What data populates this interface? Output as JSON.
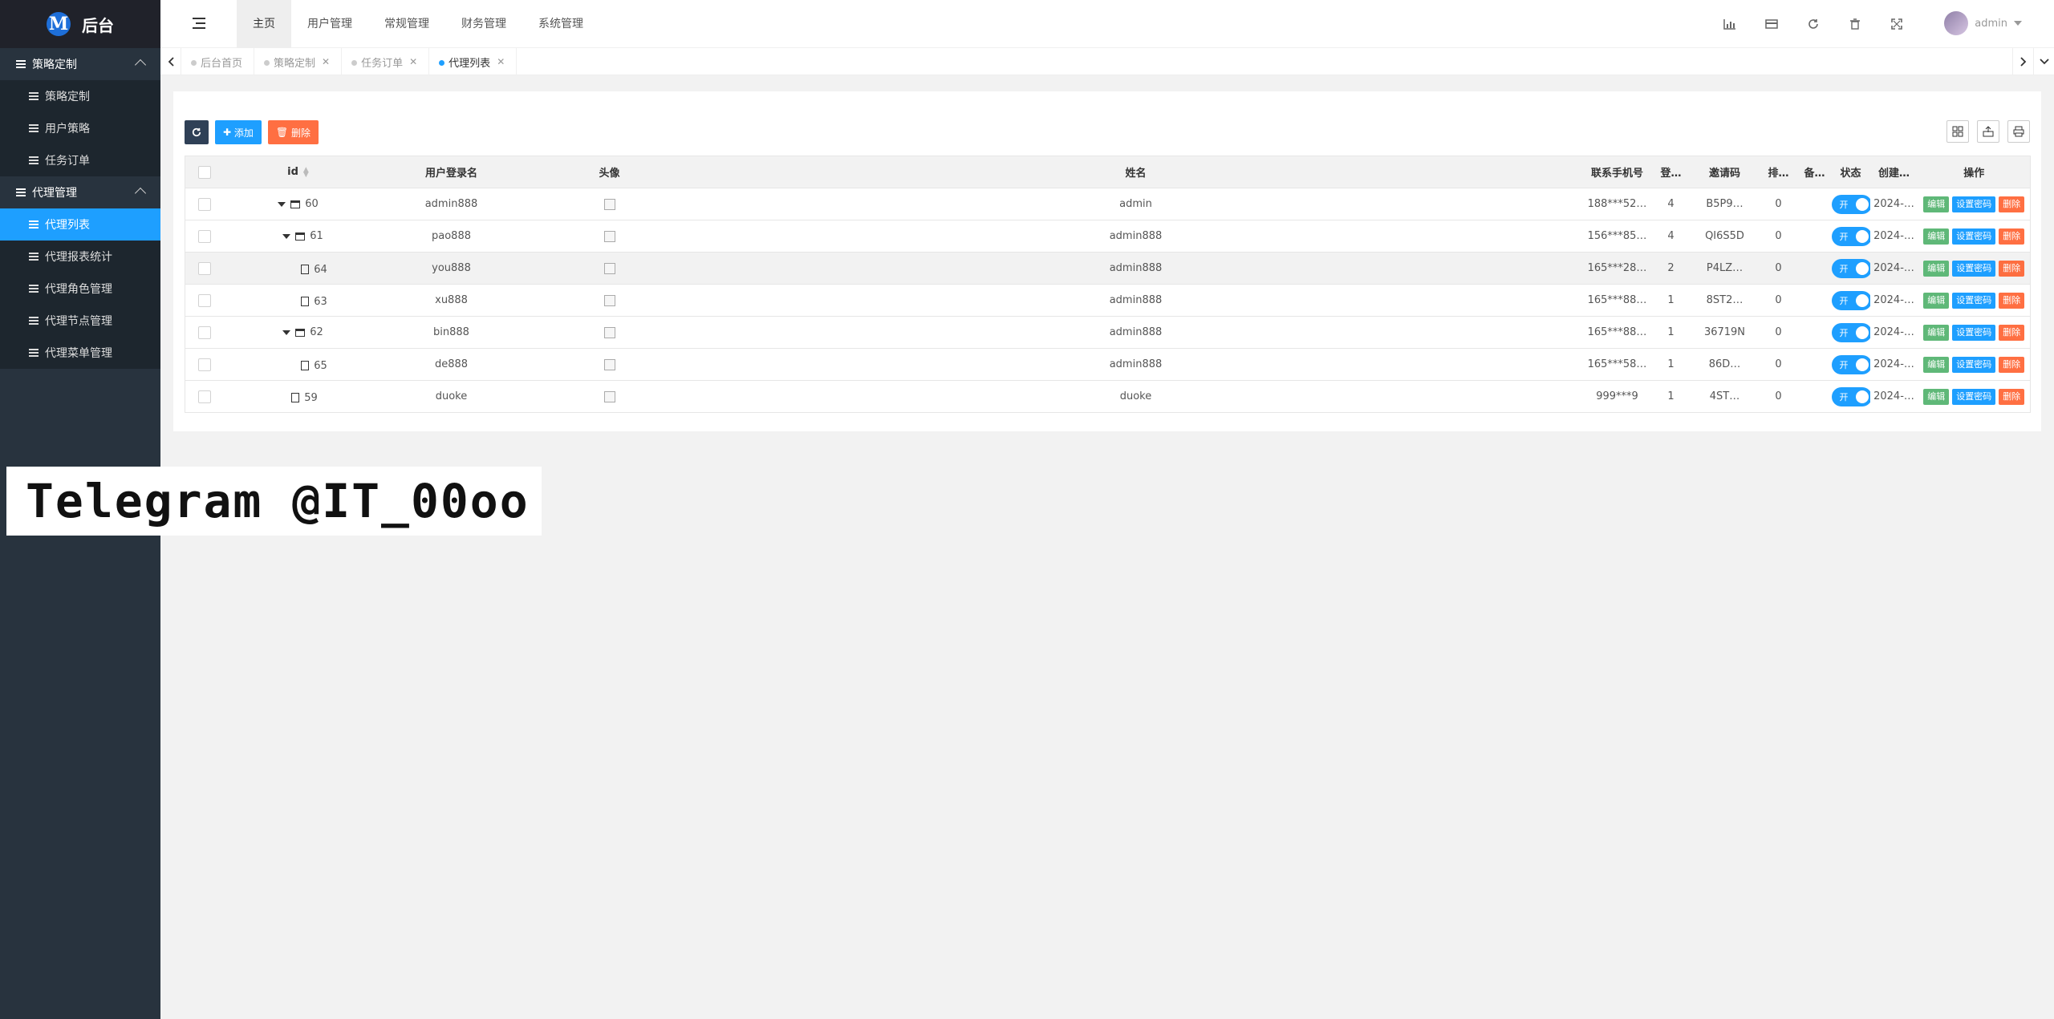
{
  "app": {
    "logo_letter": "M",
    "title": "后台"
  },
  "sidebar": {
    "groups": [
      {
        "label": "策略定制",
        "items": [
          "策略定制",
          "用户策略",
          "任务订单"
        ]
      },
      {
        "label": "代理管理",
        "items": [
          "代理列表",
          "代理报表统计",
          "代理角色管理",
          "代理节点管理",
          "代理菜单管理"
        ]
      }
    ],
    "active_item": "代理列表"
  },
  "header": {
    "nav": [
      "主页",
      "用户管理",
      "常规管理",
      "财务管理",
      "系统管理"
    ],
    "active_nav": "主页",
    "icons": [
      "chart-icon",
      "card-icon",
      "refresh-icon",
      "trash-icon",
      "fullscreen-icon"
    ],
    "user": "admin"
  },
  "tabs": [
    {
      "label": "后台首页",
      "closable": false
    },
    {
      "label": "策略定制",
      "closable": true
    },
    {
      "label": "任务订单",
      "closable": true
    },
    {
      "label": "代理列表",
      "closable": true,
      "active": true
    }
  ],
  "toolbar": {
    "add_label": "添加",
    "delete_label": "删除"
  },
  "table": {
    "headers": [
      "id",
      "用户登录名",
      "头像",
      "姓名",
      "联系手机号",
      "登…",
      "邀请码",
      "排…",
      "备…",
      "状态",
      "创建…",
      "操作"
    ],
    "rows": [
      {
        "id": "60",
        "login": "admin888",
        "name": "admin",
        "phone": "188***52…",
        "level": "4",
        "invite": "B5P9…",
        "sort": "0",
        "note": "",
        "status": "开",
        "created": "2024-…"
      },
      {
        "id": "61",
        "login": "pao888",
        "name": "admin888",
        "phone": "156***85…",
        "level": "4",
        "invite": "QI6S5D",
        "sort": "0",
        "note": "",
        "status": "开",
        "created": "2024-…"
      },
      {
        "id": "64",
        "login": "you888",
        "name": "admin888",
        "phone": "165***28…",
        "level": "2",
        "invite": "P4LZ…",
        "sort": "0",
        "note": "",
        "status": "开",
        "created": "2024-…"
      },
      {
        "id": "63",
        "login": "xu888",
        "name": "admin888",
        "phone": "165***88…",
        "level": "1",
        "invite": "8ST2…",
        "sort": "0",
        "note": "",
        "status": "开",
        "created": "2024-…"
      },
      {
        "id": "62",
        "login": "bin888",
        "name": "admin888",
        "phone": "165***88…",
        "level": "1",
        "invite": "36719N",
        "sort": "0",
        "note": "",
        "status": "开",
        "created": "2024-…"
      },
      {
        "id": "65",
        "login": "de888",
        "name": "admin888",
        "phone": "165***58…",
        "level": "1",
        "invite": "86D…",
        "sort": "0",
        "note": "",
        "status": "开",
        "created": "2024-…"
      },
      {
        "id": "59",
        "login": "duoke",
        "name": "duoke",
        "phone": "999***9",
        "level": "1",
        "invite": "4ST…",
        "sort": "0",
        "note": "",
        "status": "开",
        "created": "2024-…"
      }
    ],
    "actions": {
      "edit": "编辑",
      "password": "设置密码",
      "delete": "删除"
    }
  },
  "watermark": "Telegram @IT_00oo",
  "colors": {
    "accent": "#1e9fff",
    "sidebar": "#28333e",
    "edit": "#5fb878",
    "danger": "#ff5722"
  }
}
